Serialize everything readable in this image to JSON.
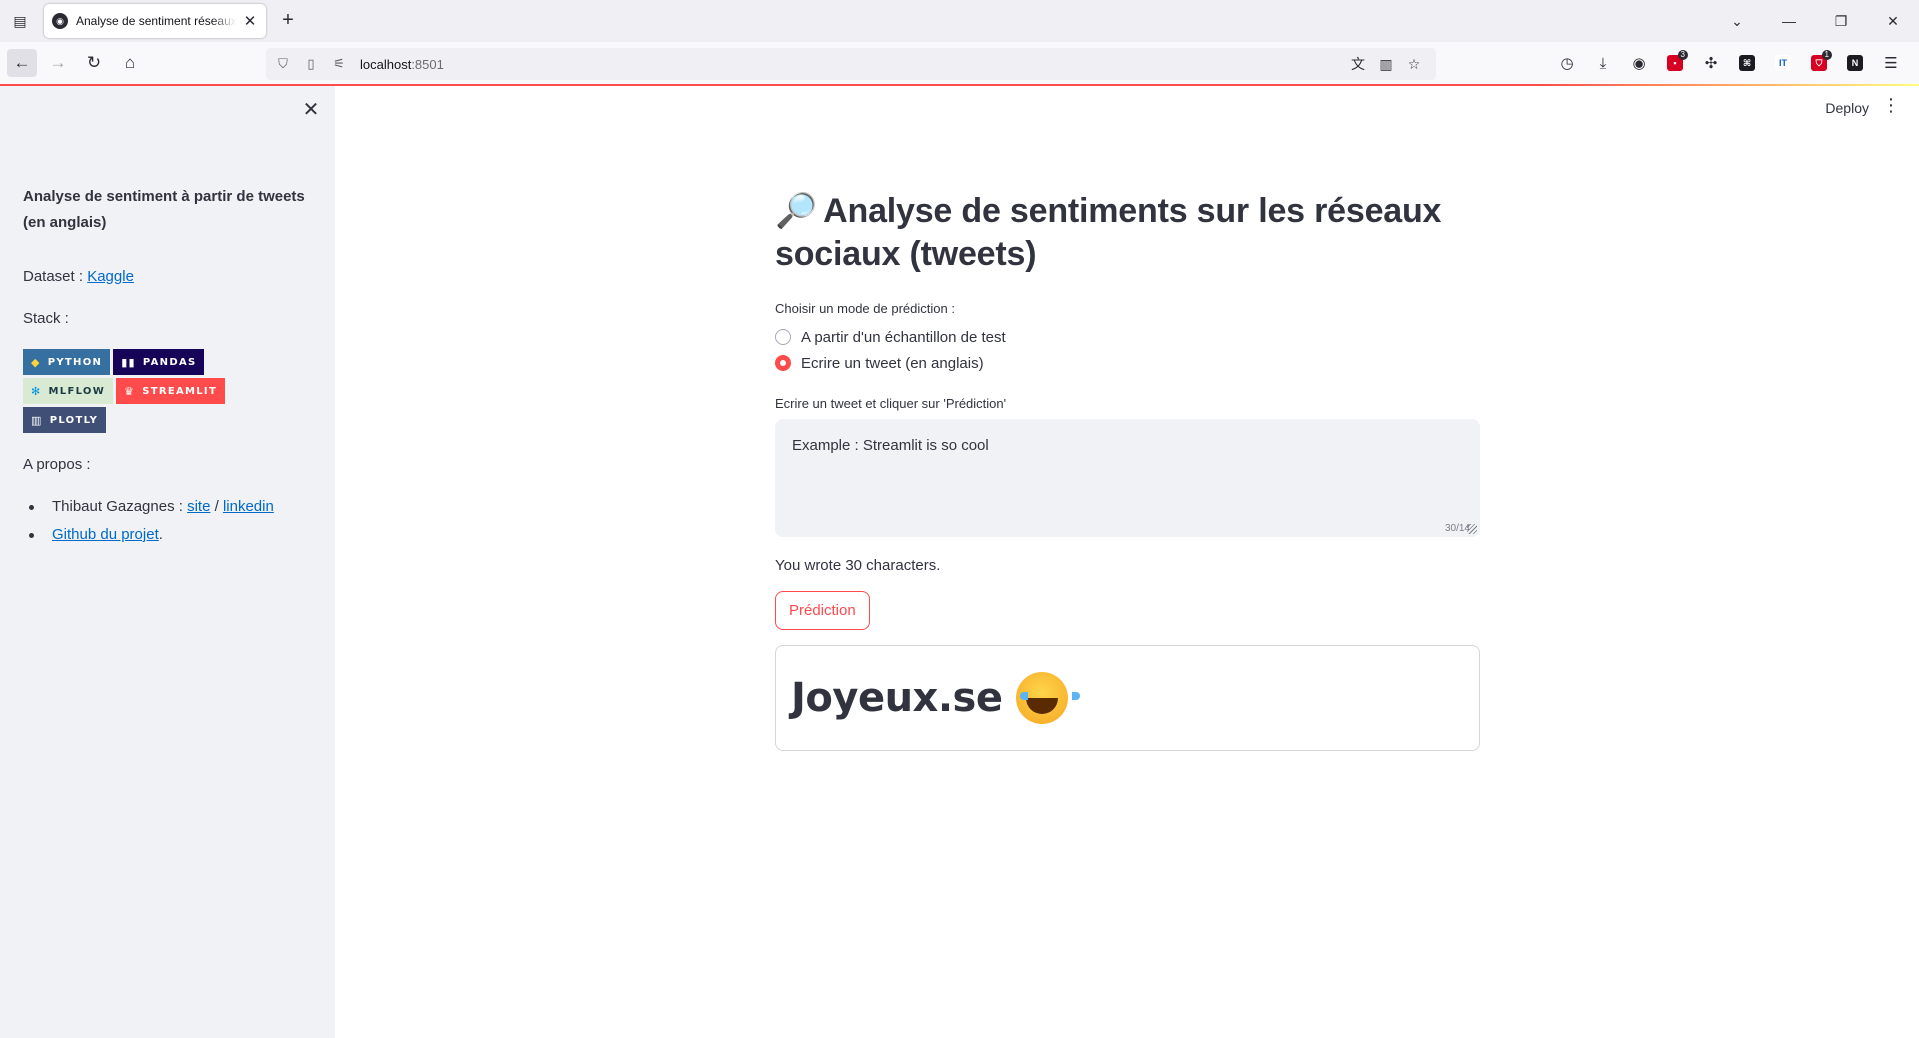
{
  "browser": {
    "tab_title": "Analyse de sentiment réseaux sociaux",
    "url_host": "localhost",
    "url_port": ":8501",
    "extension_badges": {
      "ext1": "3",
      "ext2": "1"
    }
  },
  "sidebar": {
    "title": "Analyse de sentiment à partir de tweets (en anglais)",
    "dataset_label": "Dataset : ",
    "dataset_link": "Kaggle",
    "stack_label": "Stack :",
    "badges": [
      {
        "label": "PYTHON",
        "color": "#3670a0"
      },
      {
        "label": "PANDAS",
        "color": "#150458"
      },
      {
        "label": "MLFLOW",
        "color": "#d9ead3"
      },
      {
        "label": "STREAMLIT",
        "color": "#ff4b4b"
      },
      {
        "label": "PLOTLY",
        "color": "#3f4f75"
      }
    ],
    "about_label": "A propos :",
    "about_items": {
      "author": "Thibaut Gazagnes : ",
      "site": "site",
      "sep": " / ",
      "linkedin": "linkedin",
      "github": "Github du projet",
      "github_suffix": "."
    }
  },
  "header": {
    "deploy": "Deploy"
  },
  "main": {
    "title_emoji": "🔎",
    "title": "Analyse de sentiments sur les réseaux sociaux (tweets)",
    "mode_label": "Choisir un mode de prédiction :",
    "options": [
      "A partir d'un échantillon de test",
      "Ecrire un tweet (en anglais)"
    ],
    "selected_option": 1,
    "input_label": "Ecrire un tweet et cliquer sur 'Prédiction'",
    "input_value": "Example : Streamlit is so cool",
    "char_count": "30/14",
    "wrote_text": "You wrote 30 characters.",
    "predict_button": "Prédiction",
    "result_text": "Joyeux.se",
    "result_emoji": "tears-of-joy-emoji"
  },
  "colors": {
    "accent": "#ff4b4b",
    "sidebar_bg": "#f0f2f6",
    "link": "#0068c9",
    "text": "#31333f"
  }
}
